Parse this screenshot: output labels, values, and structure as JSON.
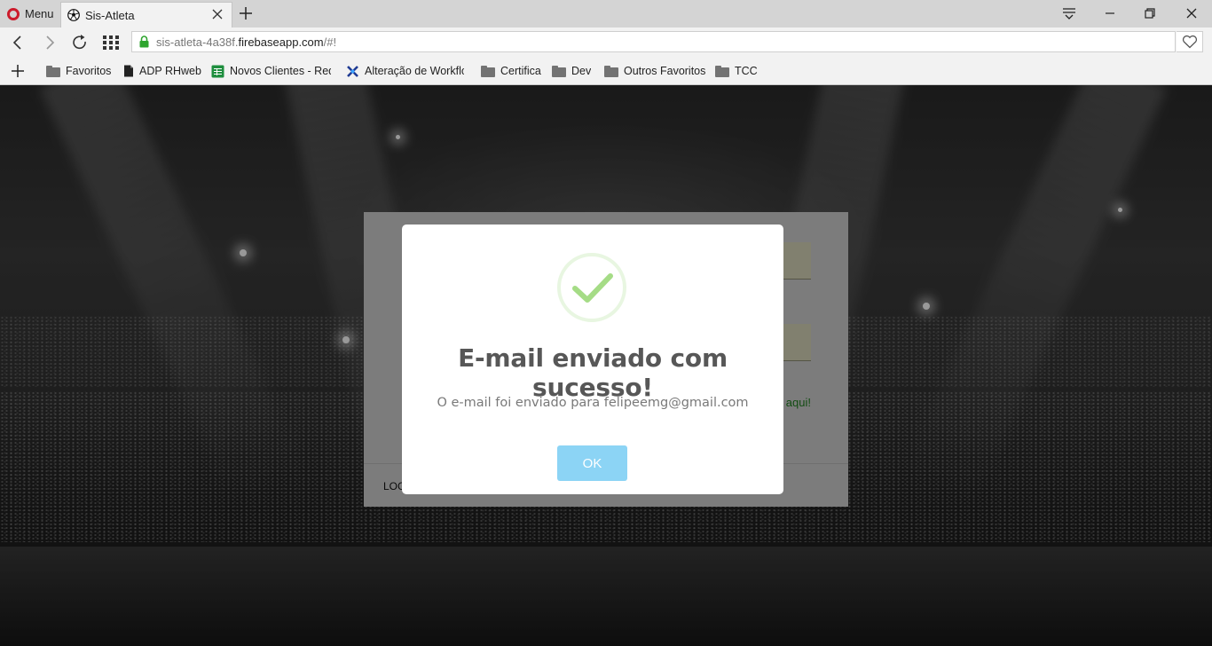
{
  "browser": {
    "menu_label": "Menu",
    "tab": {
      "title": "Sis-Atleta"
    },
    "address": {
      "url_prefix": "sis-atleta-4a38f.",
      "url_domain": "firebaseapp.com",
      "url_suffix": "/#!"
    },
    "bookmarks": [
      {
        "label": "Favoritos",
        "icon": "folder-icon"
      },
      {
        "label": "ADP RHweb",
        "icon": "document-icon"
      },
      {
        "label": "Novos Clientes - Rede",
        "icon": "spreadsheet-icon"
      },
      {
        "label": "Alteração de Workflow",
        "icon": "xml-icon"
      },
      {
        "label": "Certifica",
        "icon": "folder-icon"
      },
      {
        "label": "Dev",
        "icon": "folder-icon"
      },
      {
        "label": "Outros Favoritos",
        "icon": "folder-icon"
      },
      {
        "label": "TCC",
        "icon": "folder-icon"
      }
    ]
  },
  "page": {
    "login": {
      "register_link": "aqui!",
      "button_label": "LOG"
    }
  },
  "dialog": {
    "icon": "success-check-icon",
    "title": "E-mail enviado com sucesso!",
    "text": "O e-mail foi enviado para felipeemg@gmail.com",
    "ok_label": "OK"
  },
  "colors": {
    "confirm_button": "#8cd4f5",
    "success_check": "#a5dc86",
    "title_text": "#575757",
    "body_text": "#797979"
  }
}
